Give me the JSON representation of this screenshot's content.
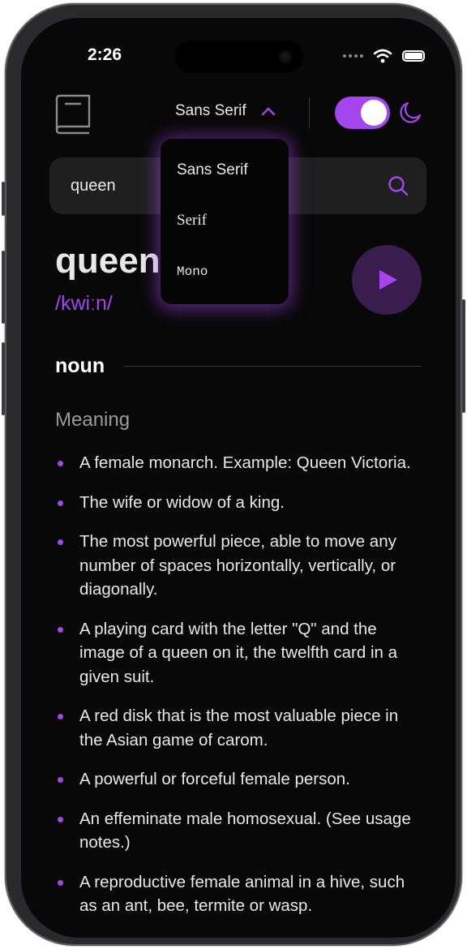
{
  "status_bar": {
    "time": "2:26"
  },
  "header": {
    "font_selected": "Sans Serif",
    "theme_toggle": "on",
    "accent_color": "#a445ed"
  },
  "font_dropdown": {
    "options": [
      "Sans Serif",
      "Serif",
      "Mono"
    ]
  },
  "search": {
    "value": "queen"
  },
  "entry": {
    "word": "queen",
    "phonetic": "/kwiːn/",
    "part_of_speech": "noun",
    "meaning_heading": "Meaning",
    "definitions": [
      "A female monarch. Example: Queen Victoria.",
      "The wife or widow of a king.",
      "The most powerful piece, able to move any number of spaces horizontally, vertically, or diagonally.",
      "A playing card with the letter \"Q\" and the image of a queen on it, the twelfth card in a given suit.",
      "A red disk that is the most valuable piece in the Asian game of carom.",
      "A powerful or forceful female person.",
      "An effeminate male homosexual. (See usage notes.)",
      "A reproductive female animal in a hive, such as an ant, bee, termite or wasp."
    ]
  },
  "icons": [
    "book-icon",
    "chevron-up-icon",
    "moon-icon",
    "search-icon",
    "play-icon",
    "wifi-icon",
    "battery-icon"
  ]
}
